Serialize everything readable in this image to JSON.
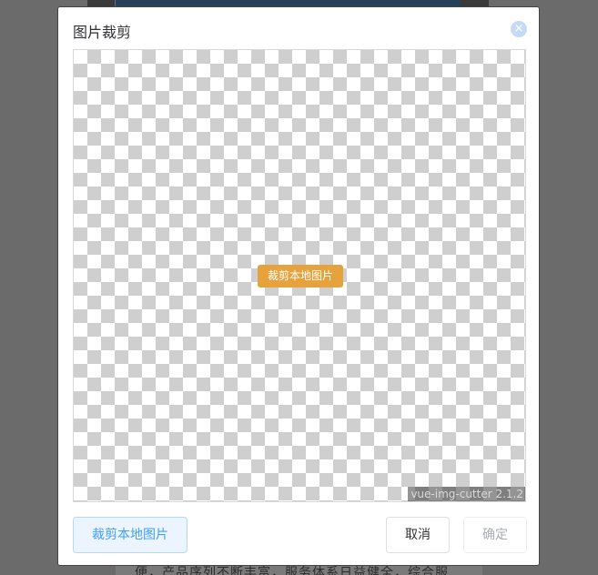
{
  "background": {
    "text": "便，产品序列不断丰富，服务体系日益健全，综合服"
  },
  "dialog": {
    "title": "图片裁剪",
    "close_icon": "close-icon",
    "close_symbol": "×",
    "cropper": {
      "upload_button_label": "裁剪本地图片",
      "version_label": "vue-img-cutter 2.1.2"
    },
    "footer": {
      "upload_label": "裁剪本地图片",
      "cancel_label": "取消",
      "confirm_label": "确定"
    }
  },
  "colors": {
    "upload_button": "#e6a23c",
    "primary": "#409eff",
    "close_button": "#c6d9f5"
  }
}
